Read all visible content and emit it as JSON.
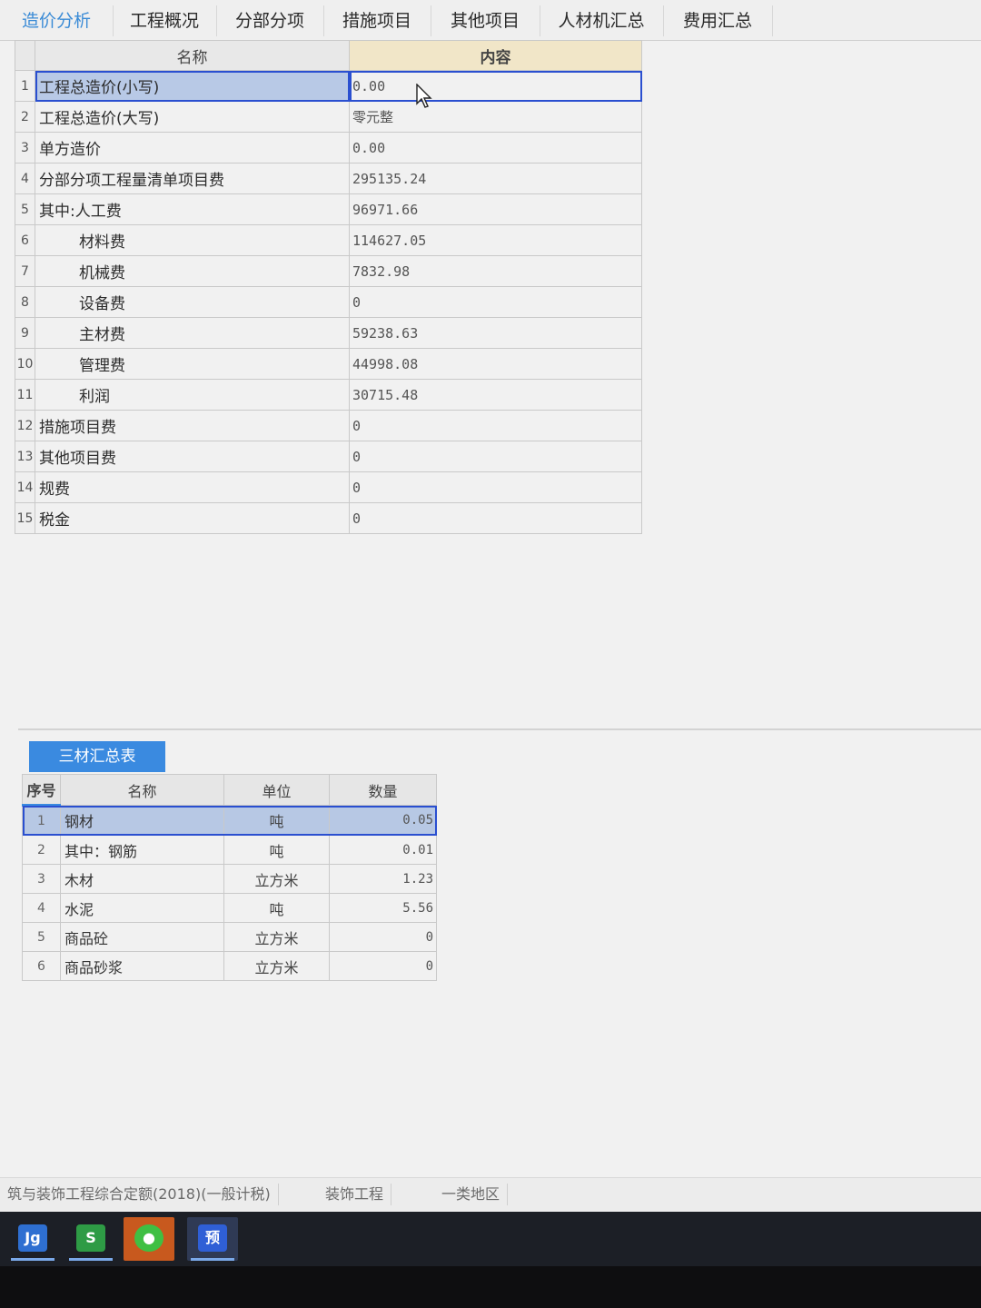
{
  "tabs": [
    {
      "label": "造价分析",
      "active": true
    },
    {
      "label": "工程概况",
      "active": false
    },
    {
      "label": "分部分项",
      "active": false
    },
    {
      "label": "措施项目",
      "active": false
    },
    {
      "label": "其他项目",
      "active": false
    },
    {
      "label": "人材机汇总",
      "active": false
    },
    {
      "label": "费用汇总",
      "active": false
    }
  ],
  "summary": {
    "header_name": "名称",
    "header_content": "内容",
    "rows": [
      {
        "num": "1",
        "name": "工程总造价(小写)",
        "value": "0.00"
      },
      {
        "num": "2",
        "name": "工程总造价(大写)",
        "value": "零元整"
      },
      {
        "num": "3",
        "name": "单方造价",
        "value": "0.00"
      },
      {
        "num": "4",
        "name": "分部分项工程量清单项目费",
        "value": "295135.24"
      },
      {
        "num": "5",
        "name": "其中:人工费",
        "value": "96971.66"
      },
      {
        "num": "6",
        "name": "材料费",
        "value": "114627.05"
      },
      {
        "num": "7",
        "name": "机械费",
        "value": "7832.98"
      },
      {
        "num": "8",
        "name": "设备费",
        "value": "0"
      },
      {
        "num": "9",
        "name": "主材费",
        "value": "59238.63"
      },
      {
        "num": "10",
        "name": "管理费",
        "value": "44998.08"
      },
      {
        "num": "11",
        "name": "利润",
        "value": "30715.48"
      },
      {
        "num": "12",
        "name": "措施项目费",
        "value": "0"
      },
      {
        "num": "13",
        "name": "其他项目费",
        "value": "0"
      },
      {
        "num": "14",
        "name": "规费",
        "value": "0"
      },
      {
        "num": "15",
        "name": "税金",
        "value": "0"
      }
    ]
  },
  "materials": {
    "tab_label": "三材汇总表",
    "headers": {
      "seq": "序号",
      "name": "名称",
      "unit": "单位",
      "qty": "数量"
    },
    "rows": [
      {
        "seq": "1",
        "name": "钢材",
        "unit": "吨",
        "qty": "0.05"
      },
      {
        "seq": "2",
        "name": "其中：钢筋",
        "unit": "吨",
        "qty": "0.01"
      },
      {
        "seq": "3",
        "name": "木材",
        "unit": "立方米",
        "qty": "1.23"
      },
      {
        "seq": "4",
        "name": "水泥",
        "unit": "吨",
        "qty": "5.56"
      },
      {
        "seq": "5",
        "name": "商品砼",
        "unit": "立方米",
        "qty": "0"
      },
      {
        "seq": "6",
        "name": "商品砂浆",
        "unit": "立方米",
        "qty": "0"
      }
    ]
  },
  "status": {
    "quota": "筑与装饰工程综合定额(2018)(一般计税)",
    "project_type": "装饰工程",
    "region": "一类地区"
  },
  "taskbar": [
    {
      "icon": "jg-app-icon",
      "glyph": "Jg",
      "color": "#2e6fd1"
    },
    {
      "icon": "spreadsheet-app-icon",
      "glyph": "S",
      "color": "#2e9b45"
    },
    {
      "icon": "wechat-icon",
      "glyph": "●",
      "color": "#3fbf43"
    },
    {
      "icon": "pricing-app-icon",
      "glyph": "预",
      "color": "#2f5fd6"
    }
  ]
}
